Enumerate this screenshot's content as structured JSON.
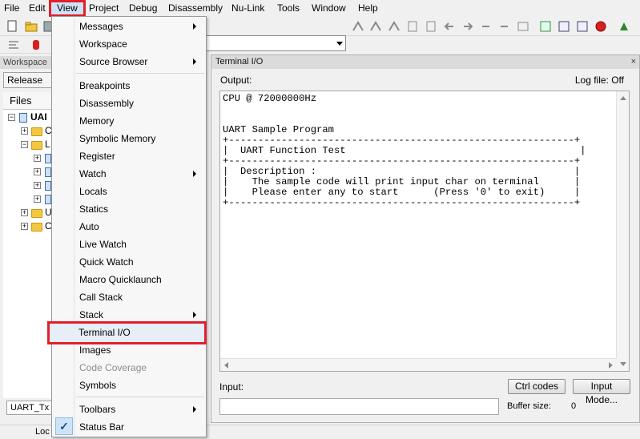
{
  "menubar": {
    "items": [
      "File",
      "Edit",
      "View",
      "Project",
      "Debug",
      "Disassembly",
      "Nu-Link",
      "Tools",
      "Window",
      "Help"
    ]
  },
  "workspace": {
    "title": "Workspace",
    "config": "Release",
    "files_header": "Files",
    "tree": [
      "UAI",
      "C",
      "L",
      "c",
      "c",
      "c",
      "c",
      "U",
      "C"
    ],
    "bottom_tab": "UART_Tx",
    "bottom_status": "Loc"
  },
  "view_menu": {
    "items": [
      {
        "label": "Messages",
        "submenu": true
      },
      {
        "label": "Workspace",
        "submenu": false
      },
      {
        "label": "Source Browser",
        "submenu": true
      },
      {
        "label": "Breakpoints",
        "submenu": false
      },
      {
        "label": "Disassembly",
        "submenu": false
      },
      {
        "label": "Memory",
        "submenu": false
      },
      {
        "label": "Symbolic Memory",
        "submenu": false
      },
      {
        "label": "Register",
        "submenu": false
      },
      {
        "label": "Watch",
        "submenu": true
      },
      {
        "label": "Locals",
        "submenu": false
      },
      {
        "label": "Statics",
        "submenu": false
      },
      {
        "label": "Auto",
        "submenu": false
      },
      {
        "label": "Live Watch",
        "submenu": false
      },
      {
        "label": "Quick Watch",
        "submenu": false
      },
      {
        "label": "Macro Quicklaunch",
        "submenu": false
      },
      {
        "label": "Call Stack",
        "submenu": false
      },
      {
        "label": "Stack",
        "submenu": true
      },
      {
        "label": "Terminal I/O",
        "submenu": false,
        "highlighted": true
      },
      {
        "label": "Images",
        "submenu": false
      },
      {
        "label": "Code Coverage",
        "submenu": false,
        "disabled": true
      },
      {
        "label": "Symbols",
        "submenu": false
      },
      {
        "label": "Toolbars",
        "submenu": true
      },
      {
        "label": "Status Bar",
        "submenu": false,
        "checked": true
      }
    ],
    "check_glyph": "✓"
  },
  "terminal": {
    "title": "Terminal I/O",
    "close_glyph": "×",
    "output_label": "Output:",
    "log_file": "Log file: Off",
    "lines": [
      "CPU @ 72000000Hz",
      "",
      "",
      "UART Sample Program",
      "+-----------------------------------------------------------+",
      "|  UART Function Test                                        |",
      "+-----------------------------------------------------------+",
      "|  Description :                                            |",
      "|    The sample code will print input char on terminal      |",
      "|    Please enter any to start      (Press '0' to exit)     |",
      "+-----------------------------------------------------------+"
    ],
    "ctrl_codes": "Ctrl codes",
    "input_mode": "Input Mode...",
    "input_label": "Input:",
    "buffer_label": "Buffer size:",
    "buffer_value": "0"
  },
  "colors": {
    "highlight_box": "#e0202a",
    "menu_bg": "#f7f7f7"
  }
}
